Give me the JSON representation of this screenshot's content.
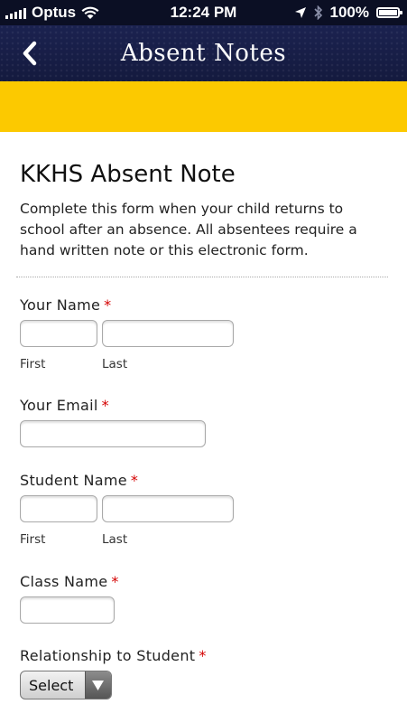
{
  "status_bar": {
    "carrier": "Optus",
    "time": "12:24 PM",
    "battery": "100%"
  },
  "nav": {
    "title": "Absent Notes",
    "back_icon": "chevron-left-icon"
  },
  "form": {
    "title": "KKHS Absent Note",
    "intro": "Complete this form when your child returns to school after an absence. All absentees require a hand written note or this electronic form.",
    "required_mark": "*",
    "your_name": {
      "label": "Your Name",
      "first_label": "First",
      "last_label": "Last",
      "first_value": "",
      "last_value": ""
    },
    "your_email": {
      "label": "Your Email",
      "value": ""
    },
    "student_name": {
      "label": "Student Name",
      "first_label": "First",
      "last_label": "Last",
      "first_value": "",
      "last_value": ""
    },
    "class_name": {
      "label": "Class Name",
      "value": ""
    },
    "relationship": {
      "label": "Relationship to Student",
      "selected": "Select"
    }
  },
  "colors": {
    "nav_bg": "#1b2250",
    "band": "#fcc900",
    "required": "#d40000"
  }
}
